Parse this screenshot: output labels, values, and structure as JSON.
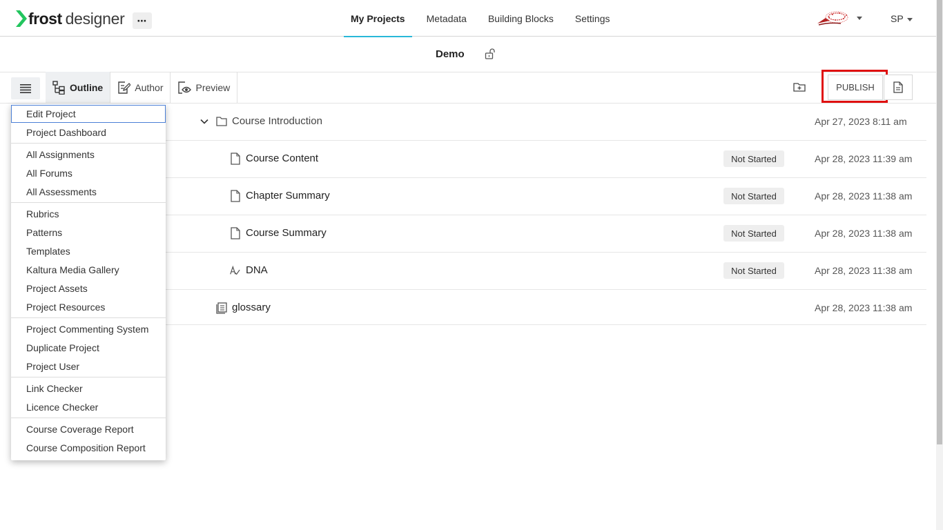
{
  "brand": {
    "name_strong": "frost",
    "name_light": "designer",
    "accent": "#22c55e"
  },
  "header": {
    "more_label": "⋯",
    "nav": [
      {
        "label": "My Projects",
        "active": true
      },
      {
        "label": "Metadata",
        "active": false
      },
      {
        "label": "Building Blocks",
        "active": false
      },
      {
        "label": "Settings",
        "active": false
      }
    ],
    "user_initials": "SP"
  },
  "project": {
    "title": "Demo"
  },
  "toolbar": {
    "views": [
      {
        "label": "Outline",
        "active": true
      },
      {
        "label": "Author",
        "active": false
      },
      {
        "label": "Preview",
        "active": false
      }
    ],
    "publish_label": "PUBLISH"
  },
  "outline": {
    "rows": [
      {
        "name": "Course Introduction",
        "type": "folder",
        "status": "",
        "date": "Apr 27, 2023 8:11 am"
      },
      {
        "name": "Course Content",
        "type": "page",
        "status": "Not Started",
        "date": "Apr 28, 2023 11:39 am"
      },
      {
        "name": "Chapter Summary",
        "type": "page",
        "status": "Not Started",
        "date": "Apr 28, 2023 11:38 am"
      },
      {
        "name": "Course Summary",
        "type": "page",
        "status": "Not Started",
        "date": "Apr 28, 2023 11:38 am"
      },
      {
        "name": "DNA",
        "type": "assessment",
        "status": "Not Started",
        "date": "Apr 28, 2023 11:38 am"
      },
      {
        "name": "glossary",
        "type": "glossary",
        "status": "",
        "date": "Apr 28, 2023 11:38 am"
      }
    ]
  },
  "menu": {
    "items": [
      "Edit Project",
      "Project Dashboard",
      "All Assignments",
      "All Forums",
      "All Assessments",
      "Rubrics",
      "Patterns",
      "Templates",
      "Kaltura Media Gallery",
      "Project Assets",
      "Project Resources",
      "Project Commenting System",
      "Duplicate Project",
      "Project User",
      "Link Checker",
      "Licence Checker",
      "Course Coverage Report",
      "Course Composition Report"
    ],
    "focused_item": "Edit Project"
  },
  "colors": {
    "nav_underline": "#28b8d8",
    "highlight_box": "#e01010",
    "focus_border": "#4a7fd6"
  }
}
